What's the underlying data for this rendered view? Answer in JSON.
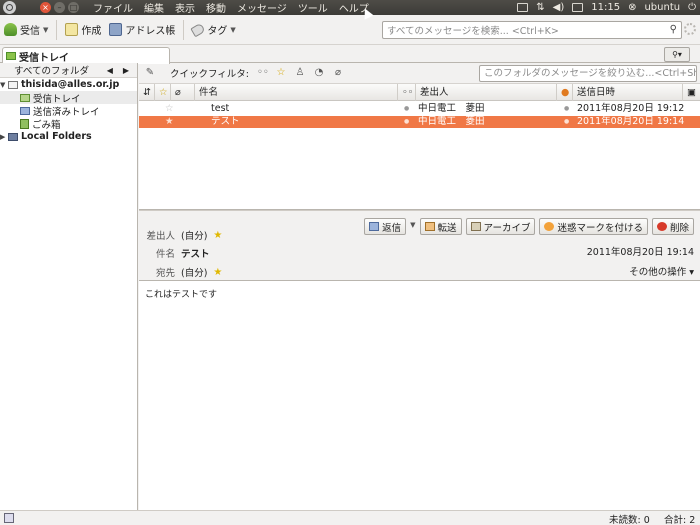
{
  "top_panel": {
    "window_buttons": [
      "×",
      "–",
      "□"
    ],
    "menus": [
      "ファイル",
      "編集",
      "表示",
      "移動",
      "メッセージ",
      "ツール",
      "ヘルプ"
    ],
    "clock": "11:15",
    "user": "ubuntu"
  },
  "toolbar": {
    "get_label": "受信",
    "write_label": "作成",
    "address_label": "アドレス帳",
    "tag_label": "タグ",
    "search_placeholder": "すべてのメッセージを検索... <Ctrl+K>"
  },
  "tabs": [
    {
      "label": "受信トレイ"
    }
  ],
  "folder_pane": {
    "header": "すべてのフォルダ",
    "nav_prev": "◀",
    "nav_next": "▶",
    "account": "thisida@alles.or.jp",
    "folders": [
      "受信トレイ",
      "送信済みトレイ",
      "ごみ箱"
    ],
    "local": "Local Folders"
  },
  "quick_filter": {
    "label": "クイックフィルタ:",
    "placeholder": "このフォルダのメッセージを絞り込む...<Ctrl+Shift+K>"
  },
  "thread_columns": {
    "subject": "件名",
    "from": "差出人",
    "date": "送信日時"
  },
  "messages": [
    {
      "subject": "test",
      "from": "中日電工　菱田",
      "date": "2011年08月20日 19:12",
      "selected": false
    },
    {
      "subject": "テスト",
      "from": "中日電工　菱田",
      "date": "2011年08月20日 19:14",
      "selected": true
    }
  ],
  "message_header": {
    "from_label": "差出人",
    "from_value": "(自分)",
    "subject_label": "件名",
    "subject_value": "テスト",
    "to_label": "宛先",
    "to_value": "(自分)",
    "date": "2011年08月20日 19:14",
    "other_actions": "その他の操作 ▾",
    "actions": {
      "reply": "返信",
      "forward": "転送",
      "archive": "アーカイブ",
      "junk": "迷惑マークを付ける",
      "delete": "削除"
    }
  },
  "message_body": "これはテストです",
  "status": {
    "unread": "未読数: 0",
    "total": "合計: 2"
  },
  "colors": {
    "selected_row": "#f07846",
    "panel": "#3c3b37"
  }
}
